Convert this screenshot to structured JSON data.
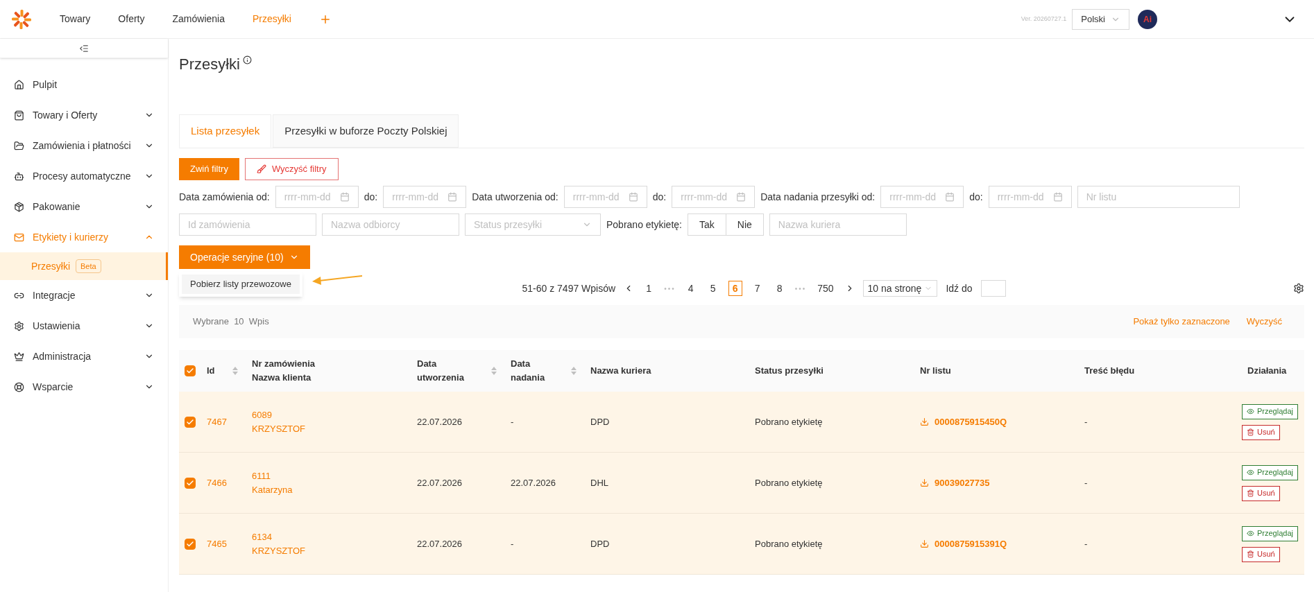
{
  "topnav": {
    "items": [
      {
        "label": "Towary",
        "selected": false
      },
      {
        "label": "Oferty",
        "selected": false
      },
      {
        "label": "Zamówienia",
        "selected": false
      },
      {
        "label": "Przesyłki",
        "selected": true
      }
    ],
    "version": "Ver. 20260727.1",
    "language": "Polski",
    "avatar_label": "Ai"
  },
  "sidebar": {
    "items": [
      {
        "label": "Pulpit"
      },
      {
        "label": "Towary i Oferty",
        "expanded": false
      },
      {
        "label": "Zamówienia i płatności",
        "expanded": false
      },
      {
        "label": "Procesy automatyczne",
        "expanded": false
      },
      {
        "label": "Pakowanie",
        "expanded": false
      },
      {
        "label": "Etykiety i kurierzy",
        "expanded": true,
        "children": [
          {
            "label": "Przesyłki",
            "badge": "Beta",
            "selected": true
          }
        ]
      },
      {
        "label": "Integracje",
        "expanded": false
      },
      {
        "label": "Ustawienia",
        "expanded": false
      },
      {
        "label": "Administracja",
        "expanded": false
      },
      {
        "label": "Wsparcie",
        "expanded": false
      }
    ]
  },
  "page_title": "Przesyłki",
  "tabs": [
    {
      "label": "Lista przesyłek",
      "selected": true
    },
    {
      "label": "Przesyłki w buforze Poczty Polskiej",
      "selected": false
    }
  ],
  "filter_buttons": {
    "collapse": "Zwiń filtry",
    "clear": "Wyczyść filtry"
  },
  "filters": {
    "row_1": [
      {
        "kind": "label",
        "text": "Data zamówienia od:"
      },
      {
        "kind": "date",
        "placeholder": "rrrr-mm-dd"
      },
      {
        "kind": "label",
        "text": "do:"
      },
      {
        "kind": "date",
        "placeholder": "rrrr-mm-dd"
      },
      {
        "kind": "label",
        "text": "Data utworzenia od:"
      },
      {
        "kind": "date",
        "placeholder": "rrrr-mm-dd"
      },
      {
        "kind": "label",
        "text": "do:"
      },
      {
        "kind": "date",
        "placeholder": "rrrr-mm-dd"
      },
      {
        "kind": "label",
        "text": "Data nadania przesyłki od:"
      },
      {
        "kind": "date",
        "placeholder": "rrrr-mm-dd"
      },
      {
        "kind": "label",
        "text": "do:"
      },
      {
        "kind": "date",
        "placeholder": "rrrr-mm-dd"
      },
      {
        "kind": "text",
        "placeholder": "Nr listu"
      }
    ],
    "row_2": [
      {
        "kind": "text",
        "placeholder": "Id zamówienia"
      },
      {
        "kind": "text",
        "placeholder": "Nazwa odbiorcy"
      },
      {
        "kind": "select",
        "placeholder": "Status przesyłki"
      },
      {
        "kind": "label",
        "text": "Pobrano etykietę:"
      },
      {
        "kind": "toggle",
        "options": [
          "Tak",
          "Nie"
        ]
      },
      {
        "kind": "text",
        "placeholder": "Nazwa kuriera"
      }
    ]
  },
  "bulk_button": "Operacje seryjne (10)",
  "bulk_menu": [
    "Pobierz listy przewozowe"
  ],
  "pagination": {
    "summary": "51-60 z 7497 Wpisów",
    "pages": [
      {
        "kind": "page",
        "label": "1",
        "selected": false
      },
      {
        "kind": "ellipsis",
        "label": "•••"
      },
      {
        "kind": "page",
        "label": "4",
        "selected": false
      },
      {
        "kind": "page",
        "label": "5",
        "selected": false
      },
      {
        "kind": "page",
        "label": "6",
        "selected": true
      },
      {
        "kind": "page",
        "label": "7",
        "selected": false
      },
      {
        "kind": "page",
        "label": "8",
        "selected": false
      },
      {
        "kind": "ellipsis",
        "label": "•••"
      },
      {
        "kind": "page",
        "label": "750",
        "selected": false
      }
    ],
    "page_size": "10 na stronę",
    "goto_label": "Idź do"
  },
  "selection_bar": {
    "label": "Wybrane",
    "count": "10",
    "unit": "Wpis",
    "show_selected": "Pokaż tylko zaznaczone",
    "clear": "Wyczyść"
  },
  "table": {
    "all_checked": true,
    "columns": [
      {
        "lines": [
          "Id"
        ],
        "sortable": true
      },
      {
        "lines": [
          "Nr zamówienia",
          "Nazwa klienta"
        ],
        "sortable": false
      },
      {
        "lines": [
          "Data",
          "utworzenia"
        ],
        "sortable": true
      },
      {
        "lines": [
          "Data",
          "nadania"
        ],
        "sortable": true
      },
      {
        "lines": [
          "Nazwa kuriera"
        ],
        "sortable": false
      },
      {
        "lines": [
          "Status przesyłki"
        ],
        "sortable": false
      },
      {
        "lines": [
          "Nr listu"
        ],
        "sortable": false
      },
      {
        "lines": [
          "Treść błędu"
        ],
        "sortable": false
      },
      {
        "lines": [
          "Działania"
        ],
        "sortable": false
      }
    ],
    "rows": [
      {
        "checked": true,
        "id": "7467",
        "order": "6089",
        "client": "KRZYSZTOF",
        "created": "22.07.2026",
        "sent": "-",
        "courier": "DPD",
        "status": "Pobrano etykietę",
        "tracking": "0000875915450Q",
        "error": "-",
        "actions": [
          "Przeglądaj",
          "Usuń"
        ]
      },
      {
        "checked": true,
        "id": "7466",
        "order": "6111",
        "client": "Katarzyna",
        "created": "22.07.2026",
        "sent": "22.07.2026",
        "courier": "DHL",
        "status": "Pobrano etykietę",
        "tracking": "90039027735",
        "error": "-",
        "actions": [
          "Przeglądaj",
          "Usuń"
        ]
      },
      {
        "checked": true,
        "id": "7465",
        "order": "6134",
        "client": "KRZYSZTOF",
        "created": "22.07.2026",
        "sent": "-",
        "courier": "DPD",
        "status": "Pobrano etykietę",
        "tracking": "0000875915391Q",
        "error": "-",
        "actions": [
          "Przeglądaj",
          "Usuń"
        ]
      }
    ]
  }
}
